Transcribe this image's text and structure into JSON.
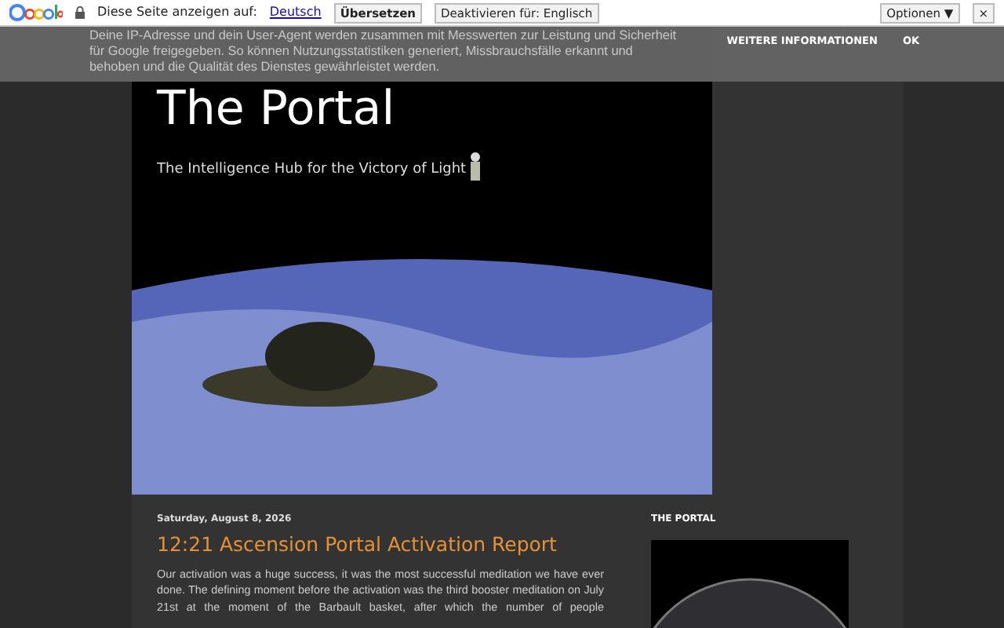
{
  "translate_bar": {
    "label": "Diese Seite anzeigen auf:",
    "language": "Deutsch",
    "translate_button": "Übersetzen",
    "disable_button": "Deaktivieren für: Englisch",
    "options_button": "Optionen ▼",
    "close": "×"
  },
  "cookie_banner": {
    "text": "Deine IP-Adresse und dein User-Agent werden zusammen mit Messwerten zur Leistung und Sicherheit für Google freigegeben. So können Nutzungsstatistiken generiert, Missbrauchsfälle erkannt und behoben und die Qualität des Dienstes gewährleistet werden.",
    "links": [
      "WEITERE INFORMATIONEN",
      "OK"
    ]
  },
  "header": {
    "title": "The Portal",
    "tagline": "The Intelligence Hub for the Victory of Light"
  },
  "post": {
    "date": "Saturday, August 8, 2026",
    "title": "12:21 Ascension Portal Activation Report",
    "body": "Our activation was a huge success, it was the most successful meditation we have ever done. The defining moment before the activation was the third booster meditation on July 21st at the moment of the Barbault basket, after which the number of people"
  },
  "sidebar": {
    "heading": "THE PORTAL"
  }
}
